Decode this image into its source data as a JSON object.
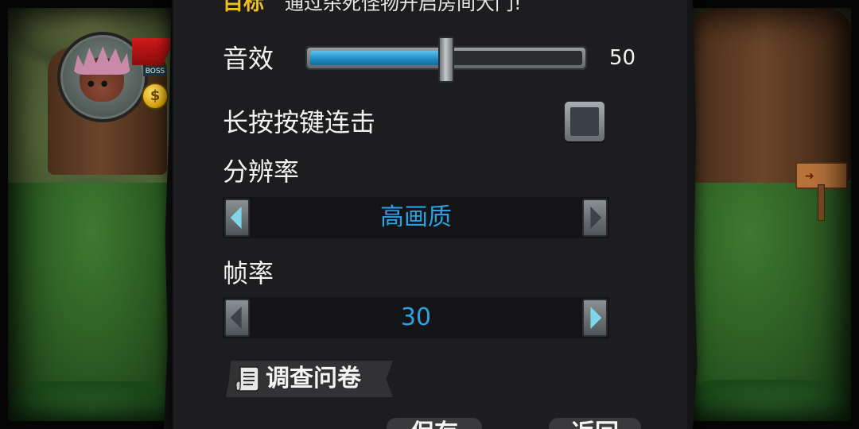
{
  "header": {
    "hint_tag": "目标",
    "hint_text": "通过杀死怪物开启房间大门!"
  },
  "hud": {
    "hp_label": "BOSS",
    "coin_symbol": "$"
  },
  "settings": {
    "sound": {
      "label": "音效",
      "value": 50,
      "value_text": "50",
      "fraction": 0.5
    },
    "hold_combo": {
      "label": "长按按键连击",
      "checked": false
    },
    "resolution": {
      "label": "分辨率",
      "value": "高画质"
    },
    "framerate": {
      "label": "帧率",
      "value": "30"
    }
  },
  "survey": {
    "label": "调查问卷"
  },
  "footer": {
    "save_label": "保存",
    "back_label": "返回"
  },
  "colors": {
    "accent_blue": "#2aa2e6",
    "panel_bg": "#1d1d1f",
    "hint_yellow": "#f0c020",
    "arrow_enabled": "#7fd6e8",
    "arrow_disabled": "#3c4246"
  },
  "icons": {
    "survey": "scroll-icon",
    "coin": "coin-icon",
    "left_arrow": "triangle-left-icon",
    "right_arrow": "triangle-right-icon"
  }
}
